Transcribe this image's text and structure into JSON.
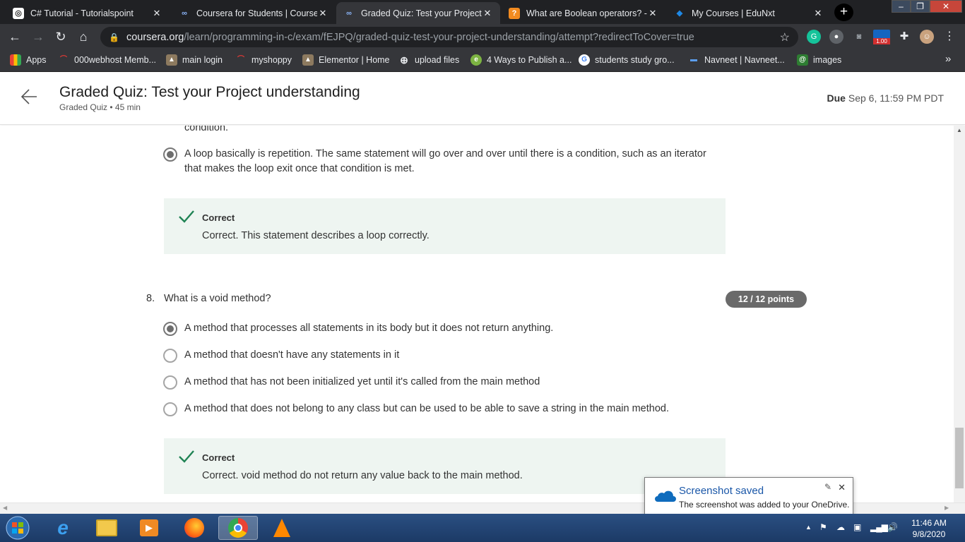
{
  "browser": {
    "tabs": [
      {
        "title": "C# Tutorial - Tutorialspoint",
        "icon": "tutorialspoint-icon"
      },
      {
        "title": "Coursera for Students | Coursera",
        "icon": "coursera-icon"
      },
      {
        "title": "Graded Quiz: Test your Project understanding",
        "icon": "coursera-icon"
      },
      {
        "title": "What are Boolean operators? - I",
        "icon": "question-icon"
      },
      {
        "title": "My Courses | EduNxt",
        "icon": "edunxt-icon"
      }
    ],
    "new_tab": "+",
    "url_domain": "coursera.org",
    "url_path": "/learn/programming-in-c/exam/fEJPQ/graded-quiz-test-your-project-understanding/attempt?redirectToCover=true",
    "extension_badge": "1.00",
    "bookmarks": [
      "Apps",
      "000webhost Memb...",
      "main login",
      "myshoppy",
      "Elementor | Home",
      "upload files",
      "4 Ways to Publish a...",
      "students study gro...",
      "Navneet | Navneet...",
      "images"
    ],
    "bookmarks_more": "»"
  },
  "page": {
    "title": "Graded Quiz: Test your Project understanding",
    "subtitle": "Graded Quiz • 45 min",
    "due_label": "Due",
    "due_date": "Sep 6, 11:59 PM PDT"
  },
  "quiz": {
    "q7_tail": "condition.",
    "q7_selected_line1": "A loop basically is repetition. The same statement will go over and over until there is a condition, such as an iterator",
    "q7_selected_line2": "that makes the loop exit once that condition is met.",
    "q7_feedback_label": "Correct",
    "q7_feedback_text": "Correct. This statement describes a loop correctly.",
    "q8_number": "8.",
    "q8_text": "What is a void method?",
    "q8_points": "12 / 12 points",
    "q8_options": [
      "A method that processes all statements in its body but it does not return anything.",
      "A method that doesn't have any statements in it",
      "A method that has not been initialized yet until it's called from the main method",
      "A method that does not belong to any class but can be used to be able to save a string in the main method."
    ],
    "q8_feedback_label": "Correct",
    "q8_feedback_text": "Correct. void method do not return any value back to the main method."
  },
  "notification": {
    "title": "Screenshot saved",
    "message": "The screenshot was added to your OneDrive."
  },
  "taskbar": {
    "time": "11:46 AM",
    "date": "9/8/2020"
  }
}
